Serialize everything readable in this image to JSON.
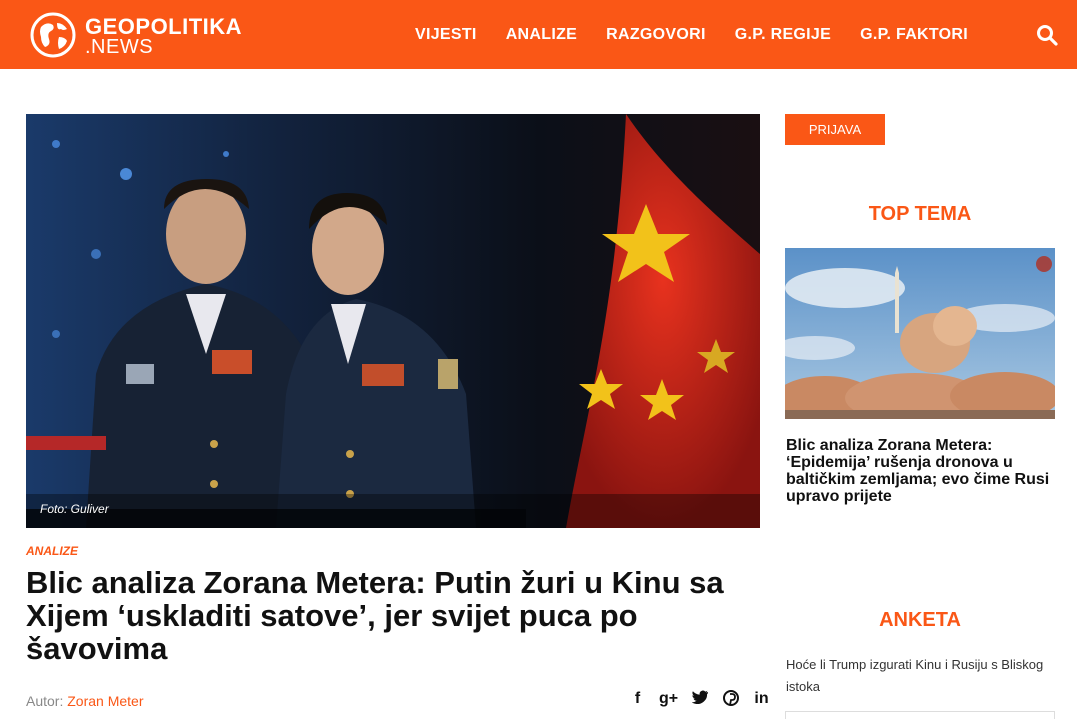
{
  "site": {
    "logo_top": "GEOPOLITIKA",
    "logo_bottom": ".NEWS",
    "nav": [
      "VIJESTI",
      "ANALIZE",
      "RAZGOVORI",
      "G.P. REGIJE",
      "G.P. FAKTORI"
    ],
    "search_icon": "search-icon",
    "brand_color": "#fa5716"
  },
  "article": {
    "photo_credit": "Foto: Guliver",
    "category": "ANALIZE",
    "title": "Blic analiza Zorana Metera: Putin žuri u Kinu sa Xijem ‘uskladiti satove’, jer svijet puca po šavovima",
    "author_label": "Autor:",
    "author_name": "Zoran Meter",
    "share_icons": [
      "facebook-icon",
      "google-plus-icon",
      "twitter-icon",
      "pinterest-icon",
      "linkedin-icon"
    ]
  },
  "sidebar": {
    "login_label": "PRIJAVA",
    "top_title": "TOP TEMA",
    "top_headline": "Blic analiza Zorana Metera: ‘Epidemija’ rušenja dronova u baltičkim zemljama; evo čime Rusi upravo prijete",
    "poll_title": "ANKETA",
    "poll_question": "Hoće li Trump izgurati Kinu i Rusiju s Bliskog istoka"
  }
}
